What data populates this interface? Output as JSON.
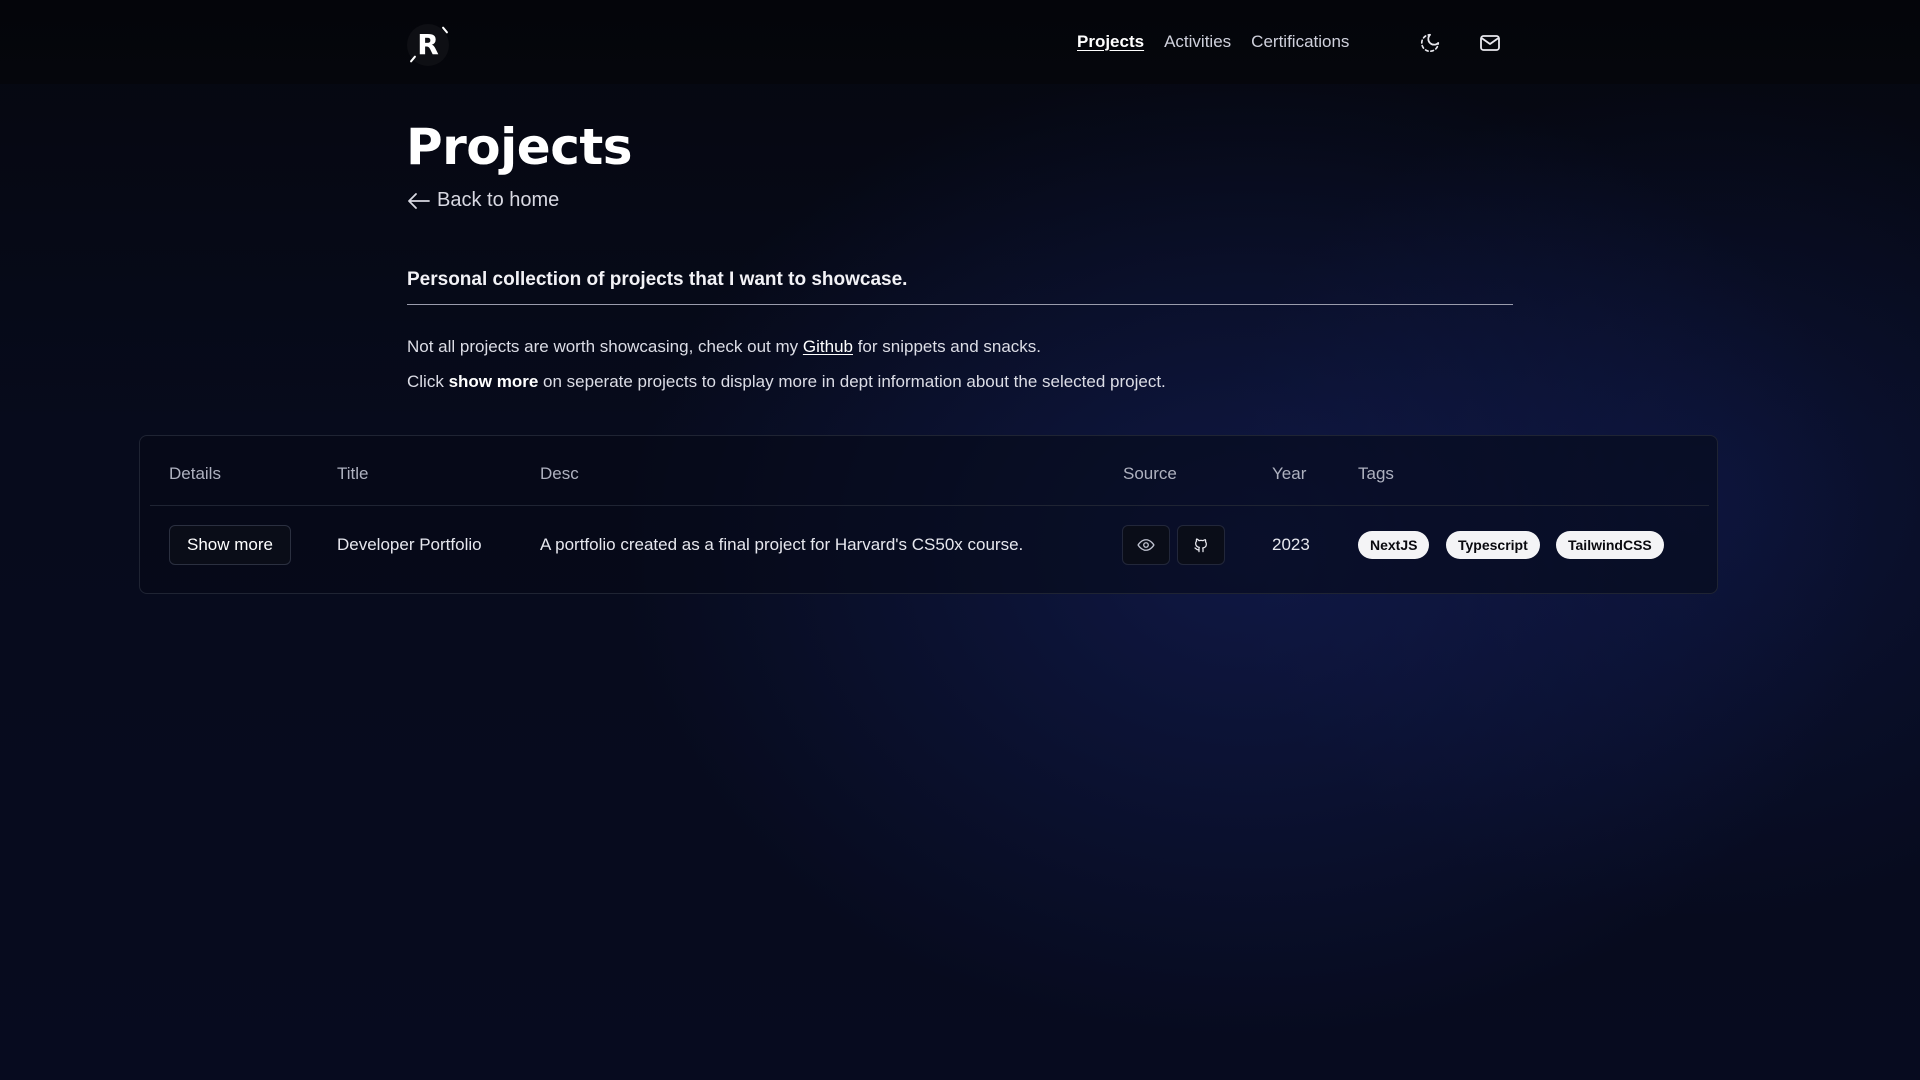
{
  "logo": {
    "letter": "R"
  },
  "nav": {
    "items": [
      {
        "label": "Projects",
        "active": true
      },
      {
        "label": "Activities",
        "active": false
      },
      {
        "label": "Certifications",
        "active": false
      }
    ],
    "theme_icon": "moon-icon",
    "mail_icon": "mail-icon"
  },
  "main": {
    "title": "Projects",
    "back_label": "Back to home",
    "subtitle": "Personal collection of projects that I want to showcase.",
    "p1": {
      "before": "Not all projects are worth showcasing, check out my ",
      "link": "Github",
      "after": " for snippets and snacks."
    },
    "p2": {
      "before": "Click ",
      "bold": "show more",
      "after": " on seperate projects to display more in dept information about the selected project."
    }
  },
  "table": {
    "headers": [
      "Details",
      "Title",
      "Desc",
      "Source",
      "Year",
      "Tags"
    ],
    "rows": [
      {
        "details_button": "Show more",
        "title": "Developer Portfolio",
        "desc": "A portfolio created as a final project for Harvard's CS50x course.",
        "source_icons": [
          "eye-icon",
          "github-icon"
        ],
        "year": "2023",
        "tags": [
          "NextJS",
          "Typescript",
          "TailwindCSS"
        ]
      }
    ]
  },
  "colors": {
    "background": "#070b1c",
    "accent_glow": "#16226a",
    "tag_bg": "#f4f4f6",
    "text": "#e8e8ee"
  }
}
